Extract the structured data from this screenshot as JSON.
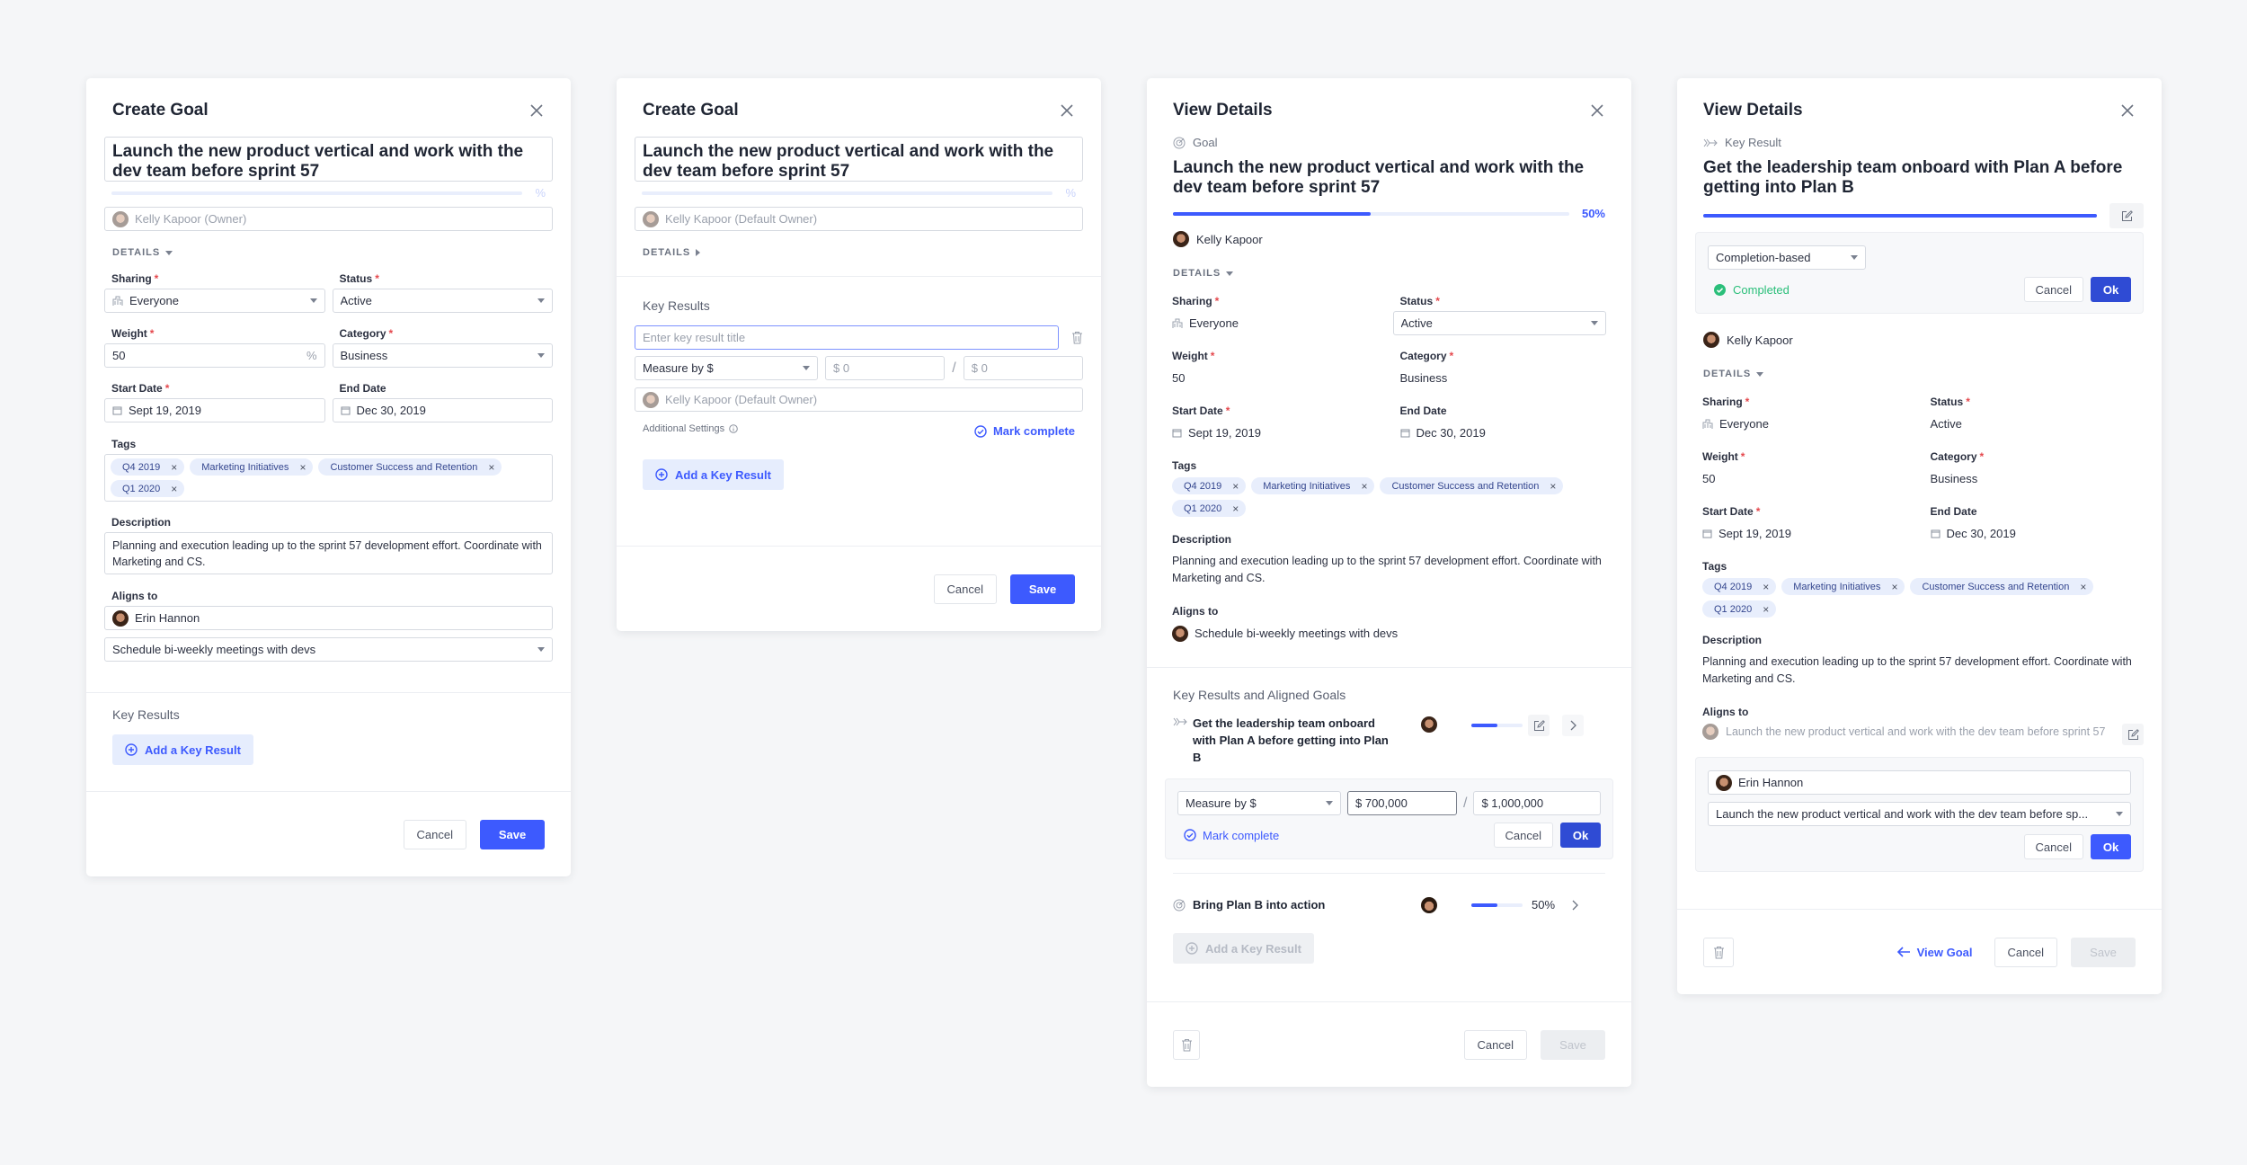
{
  "colors": {
    "accent": "#3d5afe",
    "tag_bg": "#e8eefc",
    "success": "#2bbf7a",
    "background": "#f5f6f8"
  },
  "common": {
    "goal_title": "Launch the new product vertical and work with the dev team before sprint 57",
    "details": "DETAILS",
    "sharing_label": "Sharing",
    "sharing_value": "Everyone",
    "status_label": "Status",
    "status_value": "Active",
    "weight_label": "Weight",
    "weight_value": "50",
    "weight_unit": "%",
    "category_label": "Category",
    "category_value": "Business",
    "start_label": "Start Date",
    "start_value": "Sept 19, 2019",
    "end_label": "End Date",
    "end_value": "Dec 30, 2019",
    "tags_label": "Tags",
    "tags": [
      "Q4 2019",
      "Marketing Initiatives",
      "Customer Success and Retention",
      "Q1 2020"
    ],
    "description_label": "Description",
    "description": "Planning and execution leading up to the sprint 57 development effort. Coordinate with Marketing and CS.",
    "aligns_label": "Aligns to",
    "required_mark": "*",
    "cancel": "Cancel",
    "save": "Save",
    "ok": "Ok",
    "add_kr": "Add a Key Result"
  },
  "panel1": {
    "title": "Create Goal",
    "progress_unit": "%",
    "owner_placeholder": "Kelly Kapoor (Owner)",
    "aligns_owner": "Erin Hannon",
    "aligns_goal": "Schedule bi-weekly meetings with devs",
    "key_results_label": "Key Results"
  },
  "panel2": {
    "title": "Create Goal",
    "progress_unit": "%",
    "owner_placeholder": "Kelly Kapoor (Default Owner)",
    "key_results_label": "Key Results",
    "kr_title_placeholder": "Enter key result title",
    "measure": "Measure by $",
    "current_placeholder": "$ 0",
    "separator": "/",
    "target_placeholder": "$ 0",
    "kr_owner_placeholder": "Kelly Kapoor (Default Owner)",
    "additional_settings": "Additional Settings",
    "mark_complete": "Mark complete"
  },
  "panel3": {
    "title": "View Details",
    "kind": "Goal",
    "progress": 50,
    "progress_label": "50%",
    "owner": "Kelly Kapoor",
    "aligns_goal": "Schedule bi-weekly meetings with devs",
    "section": "Key Results and Aligned Goals",
    "items": [
      {
        "title": "Get the leadership team onboard with Plan A before getting into Plan B",
        "progress": 50,
        "measure": "Measure by $",
        "current": "$ 700,000",
        "separator": "/",
        "target": "$ 1,000,000",
        "mark_complete": "Mark complete"
      },
      {
        "title": "Bring Plan B into action",
        "progress": 50,
        "progress_label": "50%"
      }
    ]
  },
  "panel4": {
    "title": "View Details",
    "kind": "Key Result",
    "title_text": "Get the leadership team onboard with Plan A before getting into Plan B",
    "progress": 100,
    "measure_type": "Completion-based",
    "completed": "Completed",
    "owner": "Kelly Kapoor",
    "aligns_goal": "Launch the new product vertical and work with the dev team before sprint 57",
    "aligns_owner": "Erin Hannon",
    "aligns_select": "Launch the new product vertical and work with the dev team before sp...",
    "view_goal": "View Goal"
  }
}
